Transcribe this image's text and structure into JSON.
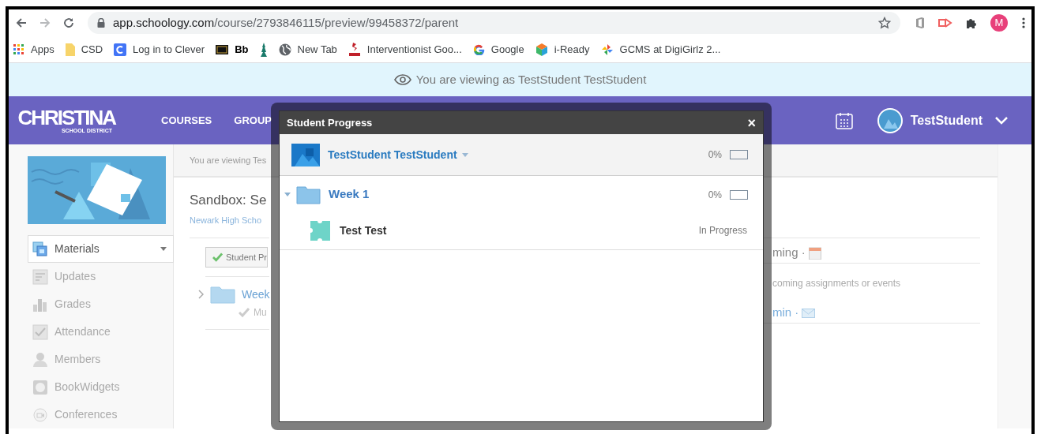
{
  "browser": {
    "url_host": "app.schoology.com",
    "url_path": "/course/2793846115/preview/99458372/parent",
    "profile_initial": "M"
  },
  "bookmarks": [
    {
      "kind": "apps",
      "label": "Apps"
    },
    {
      "kind": "folder",
      "label": "CSD"
    },
    {
      "kind": "clever",
      "label": "Log in to Clever"
    },
    {
      "kind": "bb",
      "label": "Bb"
    },
    {
      "kind": "tower"
    },
    {
      "kind": "globe",
      "label": "New Tab"
    },
    {
      "kind": "dsc",
      "label": "Interventionist Goo..."
    },
    {
      "kind": "google",
      "label": "Google"
    },
    {
      "kind": "cube",
      "label": "i-Ready"
    },
    {
      "kind": "pinwheel",
      "label": "GCMS at DigiGirlz 2..."
    }
  ],
  "banner": {
    "text": "You are viewing as TestStudent TestStudent"
  },
  "nav": {
    "logo": "CHRISTINA",
    "logo_sub": "SCHOOL DISTRICT",
    "links": [
      "COURSES",
      "GROUP"
    ],
    "user": "TestStudent"
  },
  "sidebar": {
    "items": [
      {
        "kind": "materials",
        "label": "Materials",
        "selected": true
      },
      {
        "kind": "updates",
        "label": "Updates",
        "selected": false
      },
      {
        "kind": "grades",
        "label": "Grades",
        "selected": false
      },
      {
        "kind": "attendance",
        "label": "Attendance",
        "selected": false
      },
      {
        "kind": "members",
        "label": "Members",
        "selected": false
      },
      {
        "kind": "bookwidgets",
        "label": "BookWidgets",
        "selected": false
      },
      {
        "kind": "conferences",
        "label": "Conferences",
        "selected": false
      }
    ]
  },
  "content": {
    "viewing_note": "You are viewing Tes",
    "title": "Sandbox: Se",
    "school": "Newark High Scho",
    "progress_button": "Student Pr",
    "folder": "Week",
    "folder_note": "Mu"
  },
  "right_panel": {
    "upcoming": "ming ·",
    "upcoming_empty": "coming assignments or events",
    "admin": "min ·"
  },
  "modal": {
    "title": "Student Progress",
    "close": "×",
    "student": {
      "name": "TestStudent TestStudent",
      "percent": "0%"
    },
    "folders": [
      {
        "title": "Week 1",
        "expanded": true,
        "percent": "0%",
        "children": [
          {
            "title": "Test Test",
            "status": "In Progress"
          }
        ]
      }
    ]
  }
}
